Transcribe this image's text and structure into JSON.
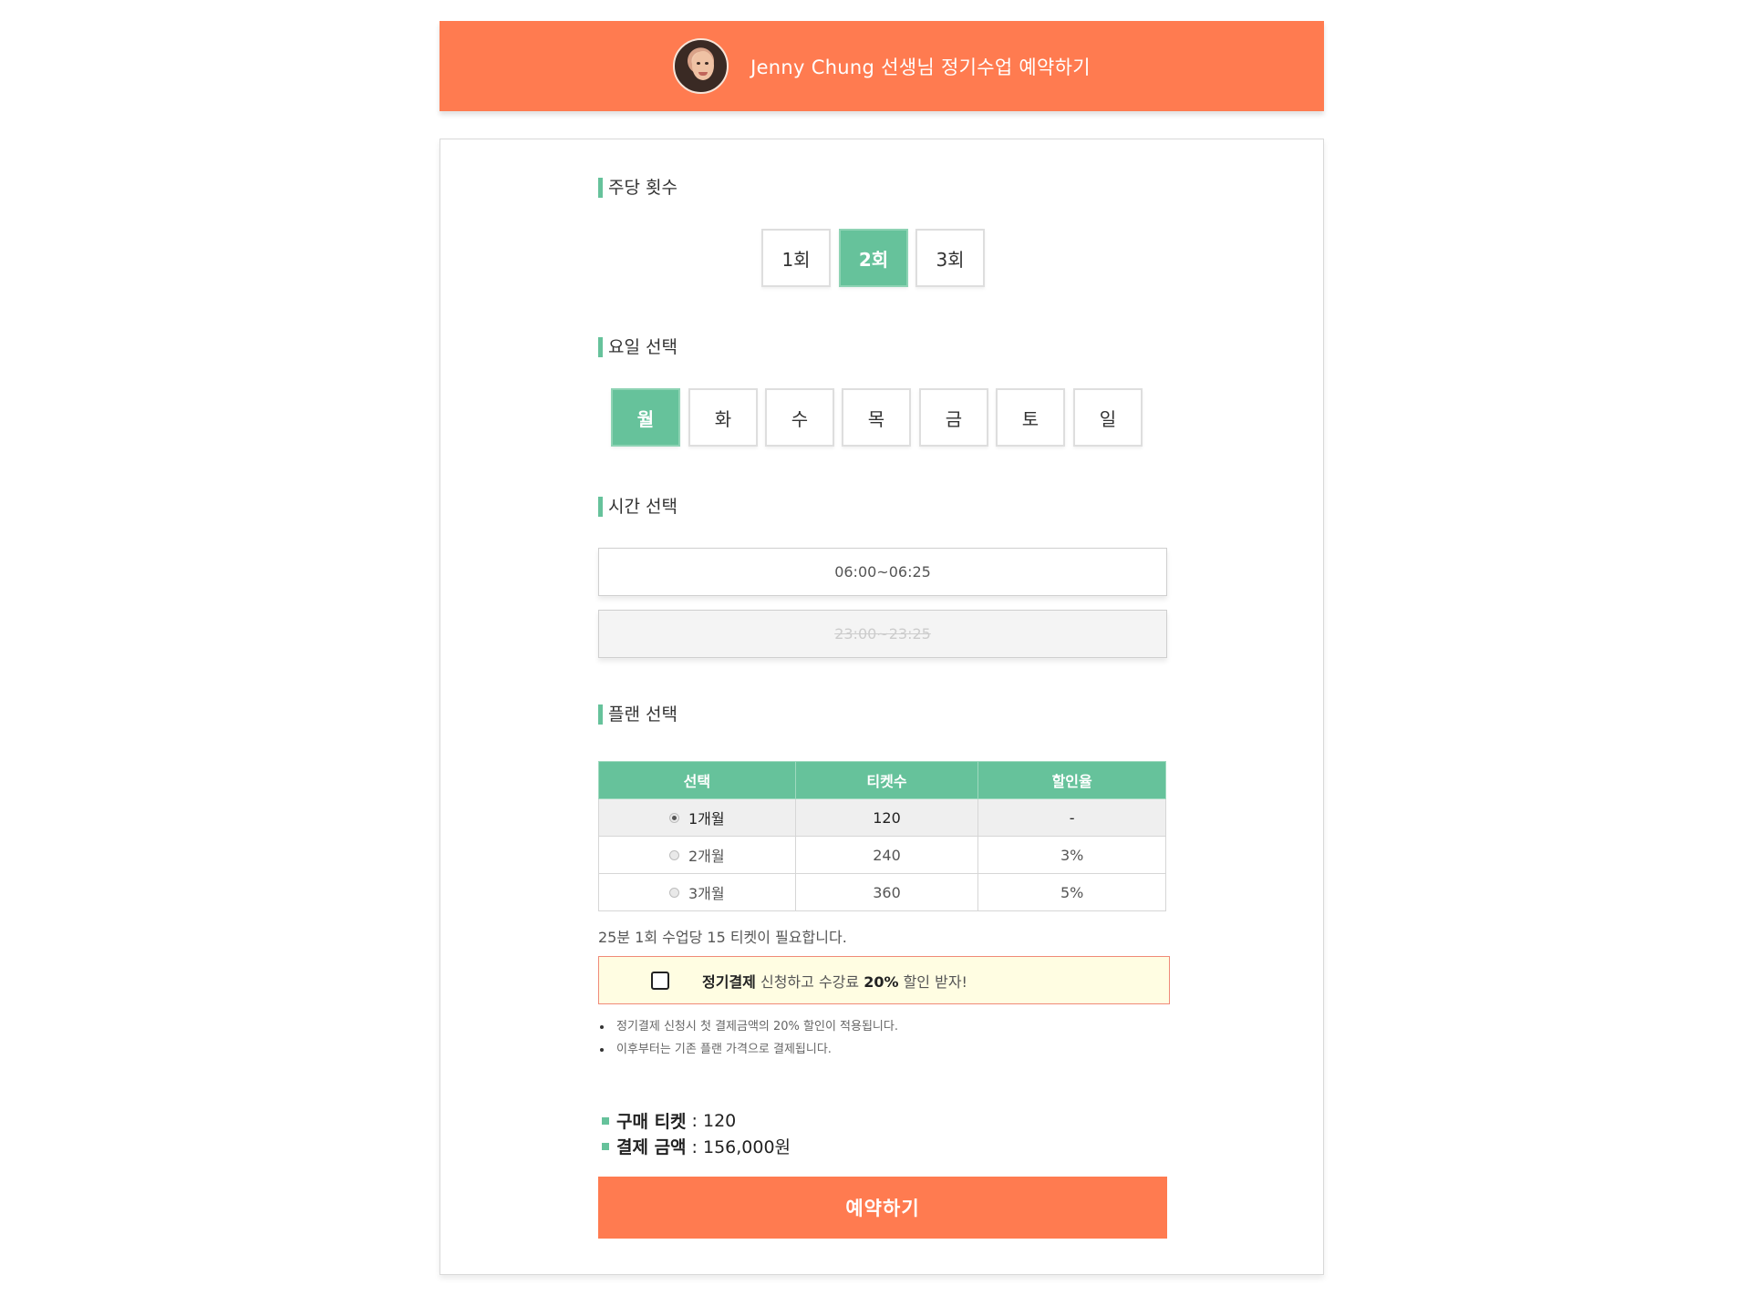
{
  "header": {
    "title": "Jenny Chung 선생님 정기수업 예약하기",
    "avatar_icon": "teacher-avatar"
  },
  "sections": {
    "frequency": "주당 횟수",
    "day": "요일 선택",
    "time": "시간 선택",
    "plan": "플랜 선택"
  },
  "frequency_options": [
    "1회",
    "2회",
    "3회"
  ],
  "frequency_selected": "2회",
  "days": [
    "월",
    "화",
    "수",
    "목",
    "금",
    "토",
    "일"
  ],
  "day_selected": "월",
  "time_slots": [
    {
      "label": "06:00~06:25",
      "disabled": false
    },
    {
      "label": "23:00~23:25",
      "disabled": true
    }
  ],
  "plan_table": {
    "headers": [
      "선택",
      "티켓수",
      "할인율"
    ],
    "rows": [
      {
        "label": "1개월",
        "tickets": "120",
        "discount": "-",
        "selected": true
      },
      {
        "label": "2개월",
        "tickets": "240",
        "discount": "3%",
        "selected": false
      },
      {
        "label": "3개월",
        "tickets": "360",
        "discount": "5%",
        "selected": false
      }
    ]
  },
  "note": "25분 1회 수업당 15 티켓이 필요합니다.",
  "promo": {
    "bold1": "정기결제",
    "text1": " 신청하고 수강료 ",
    "bold2": "20%",
    "text2": " 할인 받자!",
    "checked": false
  },
  "bullets": [
    "정기결제 신청시 첫 결제금액의 20% 할인이 적용됩니다.",
    "이후부터는 기존 플랜 가격으로 결제됩니다."
  ],
  "summary": {
    "tickets_label": "구매 티켓",
    "tickets_value": ": 120",
    "amount_label": "결제 금액",
    "amount_value": ": 156,000원"
  },
  "reserve_button": "예약하기",
  "colors": {
    "accent": "#ff7b50",
    "green": "#66c29b",
    "promo_bg": "#fffde2"
  }
}
